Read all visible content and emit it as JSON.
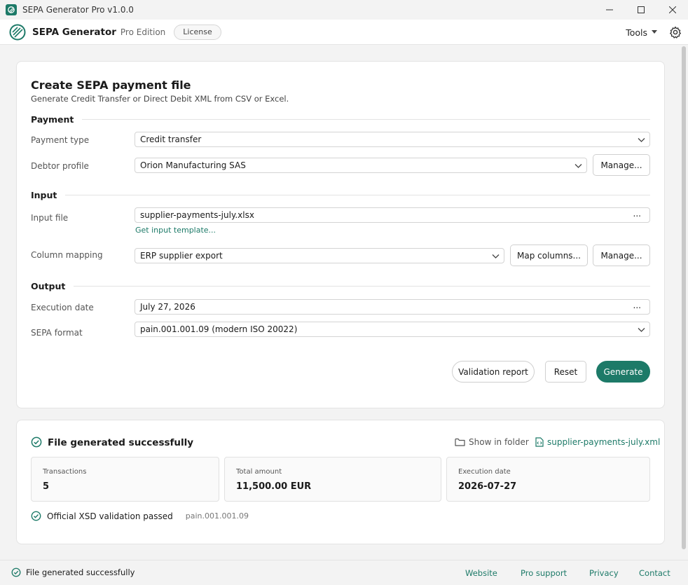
{
  "window": {
    "title": "SEPA Generator Pro v1.0.0"
  },
  "header": {
    "brand": "SEPA Generator",
    "edition": "Pro Edition",
    "license_label": "License",
    "tools_label": "Tools"
  },
  "form": {
    "title": "Create SEPA payment file",
    "subtitle": "Generate Credit Transfer or Direct Debit XML from CSV or Excel.",
    "payment_section": "Payment",
    "payment_type_label": "Payment type",
    "payment_type_value": "Credit transfer",
    "debtor_profile_label": "Debtor profile",
    "debtor_profile_value": "Orion Manufacturing SAS",
    "manage_label": "Manage...",
    "input_section": "Input",
    "input_file_label": "Input file",
    "input_file_value": "supplier-payments-july.xlsx",
    "browse_label": "...",
    "template_link": "Get input template...",
    "column_mapping_label": "Column mapping",
    "column_mapping_value": "ERP supplier export",
    "map_columns_label": "Map columns...",
    "output_section": "Output",
    "execution_date_label": "Execution date",
    "execution_date_value": "July 27, 2026",
    "sepa_format_label": "SEPA format",
    "sepa_format_value": "pain.001.001.09 (modern ISO 20022)",
    "validation_report_label": "Validation report",
    "reset_label": "Reset",
    "generate_label": "Generate"
  },
  "result": {
    "title": "File generated successfully",
    "show_in_folder": "Show in folder",
    "file_link": "supplier-payments-july.xml",
    "stats": [
      {
        "label": "Transactions",
        "value": "5"
      },
      {
        "label": "Total amount",
        "value": "11,500.00 EUR"
      },
      {
        "label": "Execution date",
        "value": "2026-07-27"
      }
    ],
    "xsd_text": "Official XSD validation passed",
    "xsd_format": "pain.001.001.09"
  },
  "statusbar": {
    "text": "File generated successfully",
    "links": [
      "Website",
      "Pro support",
      "Privacy",
      "Contact"
    ]
  },
  "colors": {
    "accent": "#1d7a68"
  }
}
